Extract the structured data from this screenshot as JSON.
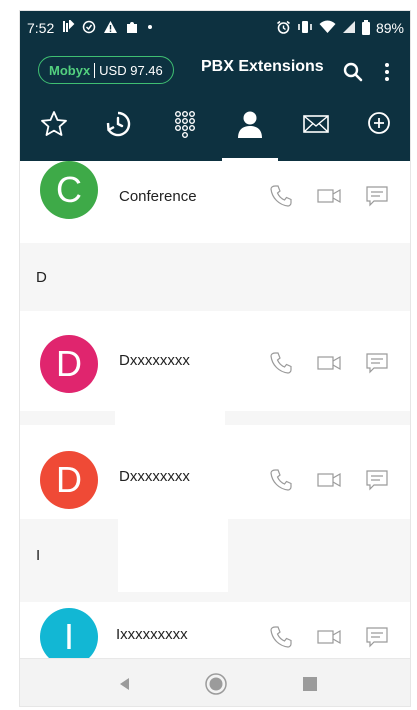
{
  "status_bar": {
    "time": "7:52",
    "battery_percent": "89%",
    "left_icons": [
      "notification-icon",
      "check-circle-icon",
      "warning-icon",
      "puzzle-icon",
      "dot-icon"
    ],
    "right_icons": [
      "alarm-icon",
      "vibrate-icon",
      "wifi-icon",
      "signal-icon",
      "battery-icon"
    ]
  },
  "app_bar": {
    "provider": "Mobyx",
    "balance": "USD 97.46",
    "title": "PBX Extensions",
    "accent_color": "#3fbf72"
  },
  "tabs": [
    {
      "icon": "star-icon",
      "active": false
    },
    {
      "icon": "history-icon",
      "active": false
    },
    {
      "icon": "dialpad-icon",
      "active": false
    },
    {
      "icon": "contacts-icon",
      "active": true
    },
    {
      "icon": "mail-icon",
      "active": false
    },
    {
      "icon": "add-icon",
      "active": false
    }
  ],
  "contacts_list": {
    "items": [
      {
        "initial": "C",
        "name": "Conference",
        "avatar_color": "#3eaa48"
      },
      {
        "section": "D"
      },
      {
        "initial": "D",
        "name": "Dxxxxxxxx",
        "avatar_color": "#e0256e"
      },
      {
        "initial": "D",
        "name": "Dxxxxxxxx",
        "avatar_color": "#ef4a36"
      },
      {
        "section": "I"
      },
      {
        "initial": "I",
        "name": "Ixxxxxxxxx",
        "avatar_color": "#12b7d4"
      }
    ]
  },
  "nav_bar": {
    "icons": [
      "back-icon",
      "home-icon",
      "recents-icon"
    ]
  },
  "colors": {
    "header_bg": "#0d3140",
    "action_icon": "#9a9a9a"
  }
}
